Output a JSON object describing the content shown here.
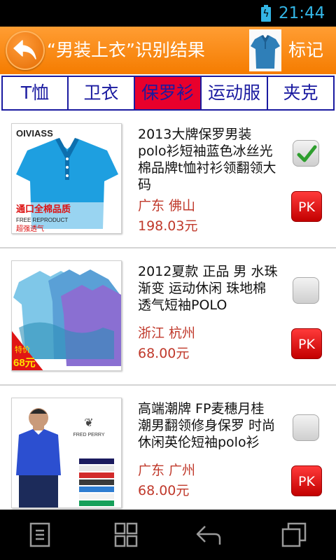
{
  "status": {
    "time": "21:44",
    "battery_color": "#33b5e5"
  },
  "header": {
    "title": "“男装上衣”识别结果",
    "mark_label": "标记",
    "accent": "#f57c00"
  },
  "tabs": [
    {
      "label": "T恤",
      "active": false
    },
    {
      "label": "卫衣",
      "active": false
    },
    {
      "label": "保罗衫",
      "active": true
    },
    {
      "label": "运动服",
      "active": false
    },
    {
      "label": "夹克",
      "active": false
    }
  ],
  "items": [
    {
      "title": "2013大牌保罗男装polo衫短袖蓝色冰丝光棉品牌t恤衬衫领翻领大码",
      "location": "广东 佛山",
      "price": "198.03元",
      "checked": true,
      "pk_label": "PK",
      "image_text": {
        "brand": "OIVIASS",
        "promo": "通口全棉品质",
        "promo_sub": "FREE REPRODUCT",
        "promo_foot": "超强透气"
      }
    },
    {
      "title": "2012夏款 正品 男 水珠渐变 运动休闲 珠地棉 透气短袖POLO",
      "location": "浙江 杭州",
      "price": "68.00元",
      "checked": false,
      "pk_label": "PK",
      "image_text": {
        "tag_top": "特价",
        "tag_price": "68元"
      }
    },
    {
      "title": "高端潮牌 FP麦穗月桂 潮男翻领修身保罗 时尚休闲英伦短袖polo衫",
      "location": "广东 广州",
      "price": "68.00元",
      "checked": false,
      "pk_label": "PK",
      "image_text": {
        "brand": "FRED PERRY"
      }
    }
  ],
  "navbar": {
    "icons": [
      "menu-icon",
      "grid-icon",
      "back-icon",
      "recent-apps-icon"
    ]
  }
}
